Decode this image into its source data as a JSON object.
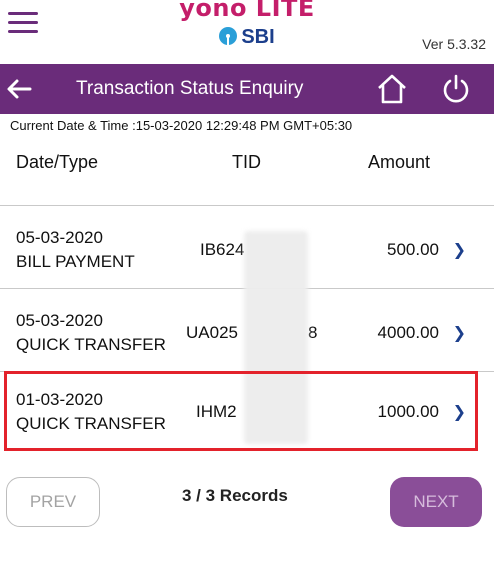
{
  "brand": {
    "line1": "yono LITE",
    "line2": "SBI"
  },
  "version": "Ver 5.3.32",
  "header": {
    "back_icon": "arrow-left-icon",
    "title": "Transaction Status Enquiry",
    "home_icon": "home-icon",
    "power_icon": "power-icon"
  },
  "datetime": "Current Date & Time :15-03-2020 12:29:48 PM GMT+05:30",
  "columns": {
    "date": "Date/Type",
    "tid": "TID",
    "amount": "Amount"
  },
  "transactions": [
    {
      "date": "05-03-2020",
      "type": "BILL PAYMENT",
      "tid": "IB624",
      "amount": "500.00"
    },
    {
      "date": "05-03-2020",
      "type": "QUICK TRANSFER",
      "tid": "UA025",
      "tid_tail": "8",
      "amount": "4000.00"
    },
    {
      "date": "01-03-2020",
      "type": "QUICK TRANSFER",
      "tid": "IHM2",
      "amount": "1000.00"
    }
  ],
  "pagination": {
    "prev": "PREV",
    "records": "3 / 3 Records",
    "next": "NEXT"
  },
  "colors": {
    "primary": "#6a2c7a",
    "highlight": "#e3222b",
    "brand_pink": "#c41e6a",
    "brand_blue": "#1c3f8c"
  }
}
